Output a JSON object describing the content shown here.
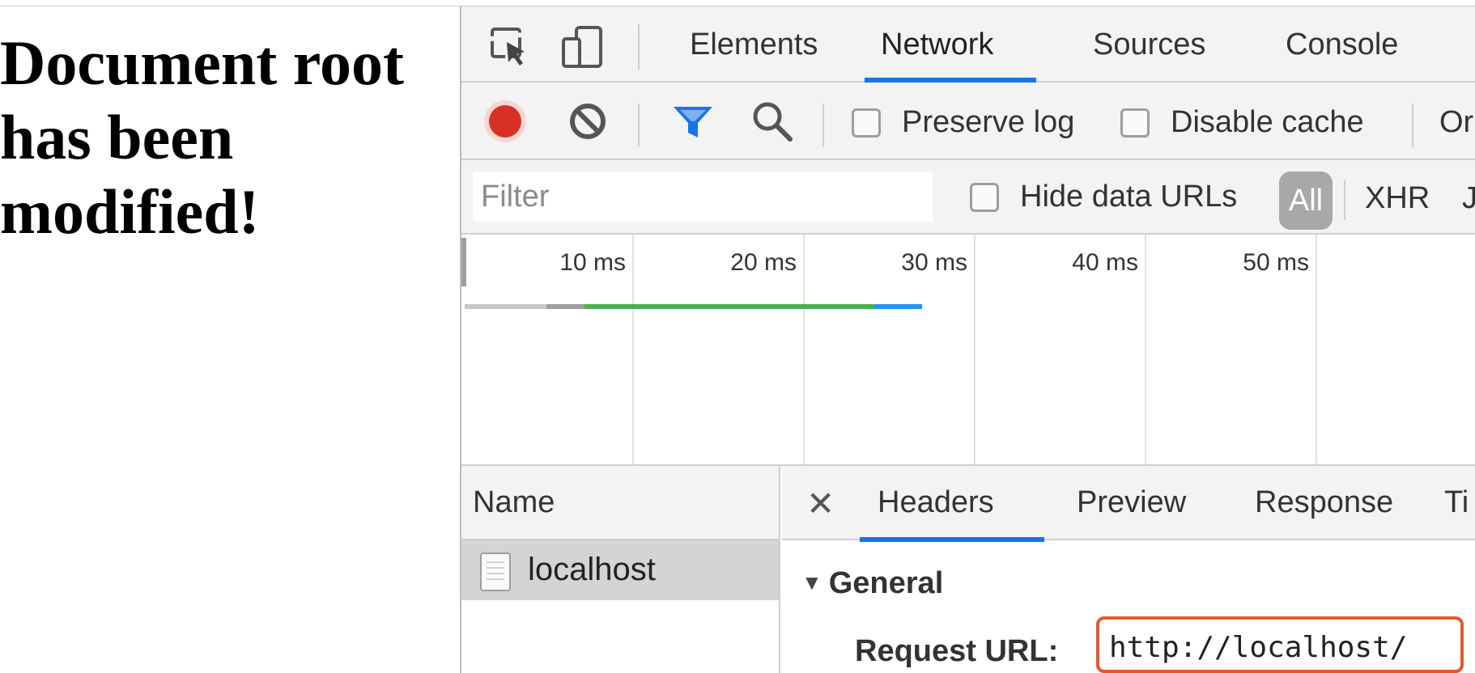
{
  "page": {
    "heading": "Document root has been modified!"
  },
  "devtools": {
    "tabs": [
      "Elements",
      "Network",
      "Sources",
      "Console"
    ],
    "active_tab": "Network",
    "toolbar": {
      "preserve_log_label": "Preserve log",
      "disable_cache_label": "Disable cache",
      "online_label_partial": "Or"
    },
    "filter": {
      "placeholder": "Filter",
      "hide_data_urls_label": "Hide data URLs",
      "types": [
        "All",
        "XHR",
        "J"
      ],
      "active_type": "All"
    },
    "overview": {
      "ticks": [
        "10 ms",
        "20 ms",
        "30 ms",
        "40 ms",
        "50 ms"
      ],
      "timing_segments_ms": [
        {
          "phase": "queue",
          "start": 0,
          "end": 4.8,
          "color": "#c8c8c8"
        },
        {
          "phase": "stalled",
          "start": 4.8,
          "end": 7.0,
          "color": "#9e9e9e"
        },
        {
          "phase": "waiting",
          "start": 7.0,
          "end": 24.0,
          "color": "#4caf50"
        },
        {
          "phase": "download",
          "start": 24.0,
          "end": 26.8,
          "color": "#2196f3"
        }
      ]
    },
    "requests": {
      "column_name": "Name",
      "items": [
        {
          "name": "localhost",
          "selected": true
        }
      ]
    },
    "details": {
      "tabs": [
        "Headers",
        "Preview",
        "Response",
        "Ti"
      ],
      "active_tab": "Headers",
      "section": "General",
      "request_url_key": "Request URL:",
      "request_url_value": "http://localhost/"
    }
  },
  "colors": {
    "accent": "#1a73e8",
    "record": "#d93025",
    "highlight_border": "#e2572e"
  }
}
